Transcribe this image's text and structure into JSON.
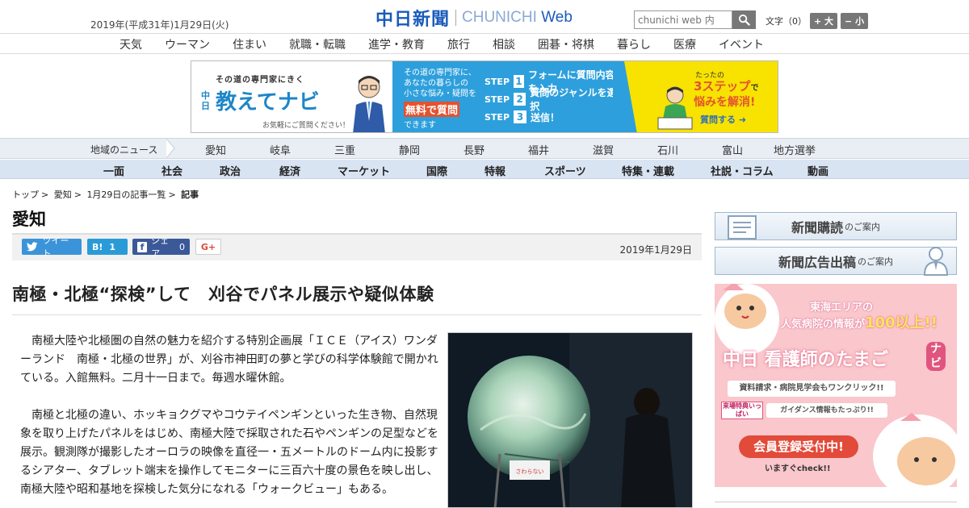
{
  "header": {
    "date": "2019年(平成31年)1月29日(火)",
    "logo_jp": "中日新聞",
    "logo_en_1": "CHUNICHI",
    "logo_en_2": "Web",
    "search_placeholder": "chunichi web 内",
    "fontsize_label": "文字（0）",
    "fontsize_up": "+ 大",
    "fontsize_down": "− 小"
  },
  "category_nav": [
    "天気",
    "ウーマン",
    "住まい",
    "就職・転職",
    "進学・教育",
    "旅行",
    "相談",
    "囲碁・将棋",
    "暮らし",
    "医療",
    "イベント"
  ],
  "banner": {
    "tagline": "その道の専門家にきく",
    "title": "教えてナビ",
    "vertical": "中日",
    "note": "お気軽にご質問ください！",
    "mid_line1": "その道の専門家に、",
    "mid_line2": "あなたの暮らしの",
    "mid_line3": "小さな悩み・疑問を",
    "mid_highlight": "無料で質問",
    "mid_line4": "できます",
    "step_word": "STEP",
    "steps": [
      {
        "num": "1",
        "text": "フォームに質問内容を入力"
      },
      {
        "num": "2",
        "text": "質問のジャンルを選択"
      },
      {
        "num": "3",
        "text": "送信！"
      }
    ],
    "right_small": "たったの",
    "right_big1": "3ステップ",
    "right_de": "で",
    "right_big2": "悩みを解消!",
    "cta": "質問する"
  },
  "regional": {
    "label": "地域のニュース",
    "items": [
      "愛知",
      "岐阜",
      "三重",
      "静岡",
      "長野",
      "福井",
      "滋賀",
      "石川",
      "富山",
      "地方選挙"
    ]
  },
  "sections": [
    "一面",
    "社会",
    "政治",
    "経済",
    "マーケット",
    "国際",
    "特報",
    "スポーツ",
    "特集・連載",
    "社説・コラム",
    "動画"
  ],
  "breadcrumb": [
    "トップ",
    "愛知",
    "1月29日の記事一覧",
    "記事"
  ],
  "section_title": "愛知",
  "share": {
    "tweet": "ツイート",
    "hatena": "B!",
    "hatena_count": "1",
    "facebook_icon": "f",
    "facebook": "シェア",
    "facebook_count": "0",
    "gplus": "G+"
  },
  "article": {
    "date": "2019年1月29日",
    "headline": "南極・北極“探検”して　刈谷でパネル展示や疑似体験",
    "paragraphs": [
      "南極大陸や北極圏の自然の魅力を紹介する特別企画展「ＩＣＥ（アイス）ワンダーランド　南極・北極の世界」が、刈谷市神田町の夢と学びの科学体験館で開かれている。入館無料。二月十一日まで。毎週水曜休館。",
      "南極と北極の違い、ホッキョクグマやコウテイペンギンといった生き物、自然現象を取り上げたパネルをはじめ、南極大陸で採取された石やペンギンの足型などを展示。観測隊が撮影したオーロラの映像を直径一・五メートルのドーム内に投影するシアター、タブレット端末を操作してモニターに三百六十度の景色を映し出し、南極大陸や昭和基地を探検した気分になれる「ウォークビュー」もある。"
    ],
    "photo_sign": "さわらない"
  },
  "sidebar": {
    "subscribe": "新聞購読",
    "subscribe_small": "のご案内",
    "ads": "新聞広告出稿",
    "ads_small": "のご案内",
    "nurse_top1": "東海エリアの",
    "nurse_top2": "人気病院の情報が",
    "nurse_num": "100以上!!",
    "nurse_title": "中日 看護師のたまご",
    "nurse_navi": "ナビ",
    "nurse_b1": "資料請求・病院見学会もワンクリック!!",
    "nurse_b2_tag": "来場特典いっぱい",
    "nurse_b2": "ガイダンス情報もたっぷり!!",
    "nurse_cta": "会員登録受付中!",
    "nurse_cta_sub": "いますぐcheck!!"
  }
}
